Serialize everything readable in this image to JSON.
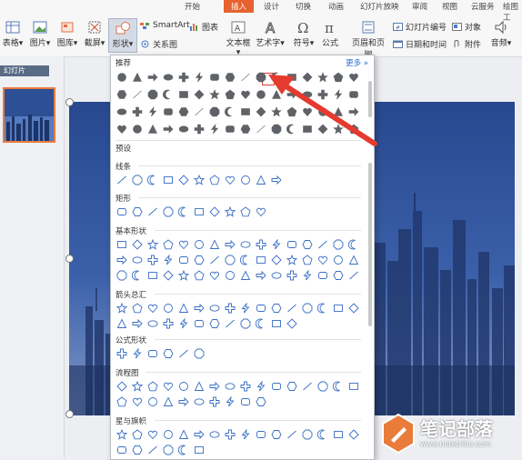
{
  "ribbon": {
    "tabs": [
      {
        "label": "开始"
      },
      {
        "label": "插入"
      },
      {
        "label": "设计"
      },
      {
        "label": "切换"
      },
      {
        "label": "动画"
      },
      {
        "label": "幻灯片放映"
      },
      {
        "label": "审阅"
      },
      {
        "label": "视图"
      },
      {
        "label": "云服务"
      },
      {
        "label": "绘图工"
      }
    ],
    "buttons": {
      "table": "表格▾",
      "picture": "图片▾",
      "gallery": "图库▾",
      "screenshot": "截屏▾",
      "shapes": "形状▾",
      "textbox": "文本框▾",
      "wordart": "艺术字▾",
      "symbol": "符号▾",
      "formula": "公式",
      "header_footer": "页眉和页脚",
      "audio": "音频▾"
    },
    "inline": {
      "smartart": "SmartArt",
      "chart": "图表",
      "relation": "关系图",
      "slide_number": "幻灯片编号",
      "object": "对象",
      "datetime": "日期和时间",
      "attachment": "附件"
    }
  },
  "slide_panel": {
    "tab_label": "幻灯片"
  },
  "dropdown": {
    "recommended_label": "推荐",
    "more_label": "更多 »",
    "preset_label": "预设",
    "sections": [
      {
        "label": "线条"
      },
      {
        "label": "矩形"
      },
      {
        "label": "基本形状"
      },
      {
        "label": "箭头总汇"
      },
      {
        "label": "公式形状"
      },
      {
        "label": "流程图"
      },
      {
        "label": "星与旗帜"
      }
    ]
  },
  "watermark": {
    "title": "笔记部落",
    "url": "www.notetribe.com"
  },
  "colors": {
    "accent": "#e6622e",
    "arrow": "#e53a2f",
    "slide": "#2f5aa8",
    "shape_blue": "#3a6fc4"
  }
}
